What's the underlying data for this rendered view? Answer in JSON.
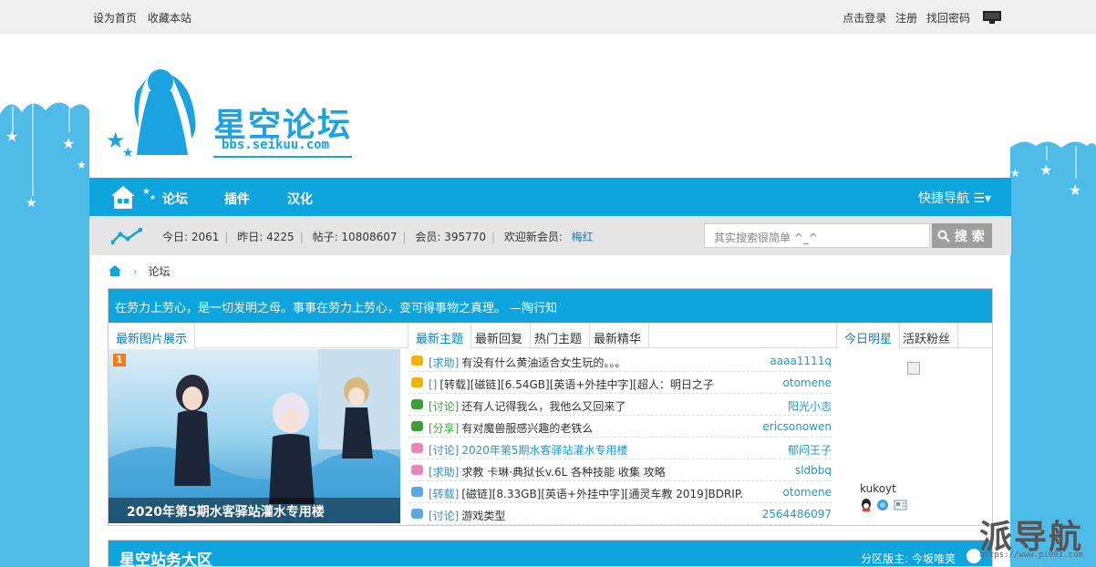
{
  "topbar": {
    "set_home": "设为首页",
    "bookmark": "收藏本站",
    "login": "点击登录",
    "register": "注册",
    "recover": "找回密码"
  },
  "logo": {
    "title": "星空论坛",
    "url": "bbs.seikuu.com"
  },
  "nav": {
    "items": [
      "论坛",
      "插件",
      "汉化"
    ],
    "quick_nav": "快捷导航 ☰▾"
  },
  "stats": {
    "today": "今日: 2061",
    "yesterday": "昨日: 4225",
    "posts": "帖子: 10808607",
    "members": "会员: 395770",
    "welcome": "欢迎新会员:",
    "new_member": "梅红"
  },
  "search": {
    "placeholder": "其实搜索很简单 ^_^",
    "button": "搜 索"
  },
  "breadcrumb": {
    "current": "论坛"
  },
  "quote": "在劳力上劳心，是一切发明之母。事事在劳力上劳心，变可得事物之真理。 —陶行知",
  "tabs_left": [
    "最新图片展示"
  ],
  "tabs_mid": [
    "最新主题",
    "最新回复",
    "热门主题",
    "最新精华"
  ],
  "tabs_right": [
    "今日明星",
    "活跃粉丝"
  ],
  "picture": {
    "badge": "1",
    "caption": "2020年第5期水客驿站灌水专用楼"
  },
  "threads": [
    {
      "cat": "[求助]",
      "title": "有没有什么黄油适合女生玩的。。。",
      "author": "aaaa1111q",
      "icon_color": "#f0b400",
      "highlight": false
    },
    {
      "cat": "[]",
      "title": "[转载][磁链][6.54GB][英语+外挂中字][超人：明日之子",
      "author": "otomene",
      "icon_color": "#f0b400",
      "highlight": false
    },
    {
      "cat": "[讨论]",
      "title": "还有人记得我么，我他么又回来了",
      "author": "阳光小志",
      "icon_color": "#3aa13a",
      "highlight": false
    },
    {
      "cat": "[分享]",
      "title": "有对魔兽服感兴趣的老铁么",
      "author": "ericsonowen",
      "icon_color": "#3aa13a",
      "highlight": false
    },
    {
      "cat": "[讨论]",
      "title": "2020年第5期水客驿站灌水专用楼",
      "author": "郁闷王子",
      "icon_color": "#e888b8",
      "highlight": true
    },
    {
      "cat": "[求助]",
      "title": "求教 卡琳·典狱长v.6L 各种技能 收集 攻略",
      "author": "sldbbq",
      "icon_color": "#e888b8",
      "highlight": false
    },
    {
      "cat": "[转载]",
      "title": "[磁链][8.33GB][英语+外挂中字][通灵车教 2019]BDRIP.",
      "author": "otomene",
      "icon_color": "#5aa8e0",
      "highlight": false
    },
    {
      "cat": "[讨论]",
      "title": "游戏类型",
      "author": "2564486097",
      "icon_color": "#5aa8e0",
      "highlight": false
    }
  ],
  "star": {
    "name": "kukoyt"
  },
  "section": {
    "title": "星空站务大区",
    "moderator": "分区版主: 今坂唯笑"
  },
  "watermark": {
    "title": "派导航",
    "url": "https://www.pi001.com"
  },
  "colors": {
    "accent": "#0ea5df",
    "sky": "#4fbbe9",
    "link": "#1a9bd4"
  }
}
